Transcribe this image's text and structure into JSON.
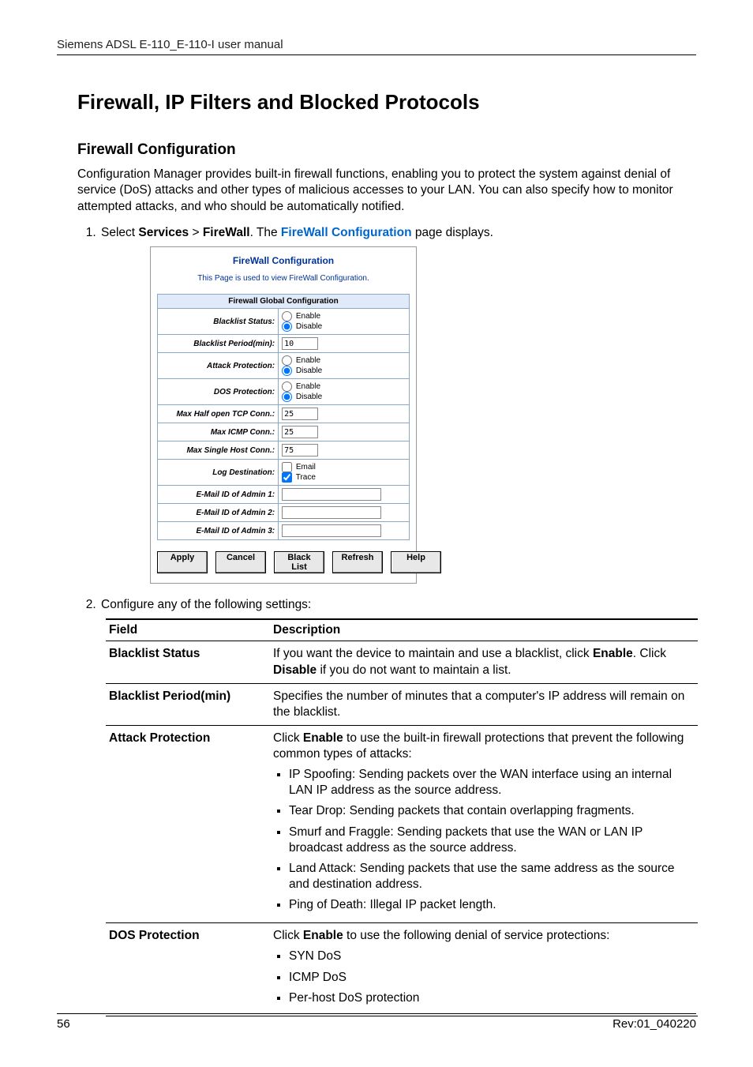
{
  "header": {
    "title": "Siemens ADSL E-110_E-110-I user manual"
  },
  "headings": {
    "h1": "Firewall, IP Filters and Blocked Protocols",
    "h2": "Firewall Configuration"
  },
  "intro": "Configuration Manager provides built-in firewall functions, enabling you to protect the system against denial of service (DoS) attacks and other types of malicious accesses to your LAN. You can also specify how to monitor attempted attacks, and who should be automatically notified.",
  "steps": {
    "one_pre": "Select ",
    "one_svc": "Services",
    "one_gt": " > ",
    "one_fw": "FireWall",
    "one_mid": ". The ",
    "one_link": "FireWall Configuration",
    "one_post": " page displays.",
    "two": "Configure any of the following settings:"
  },
  "fw_panel": {
    "title": "FireWall Configuration",
    "desc": "This Page is used to view FireWall Configuration.",
    "caption": "Firewall Global Configuration",
    "rows": {
      "blacklist_status": "Blacklist Status:",
      "blacklist_period": "Blacklist Period(min):",
      "attack_protection": "Attack Protection:",
      "dos_protection": "DOS Protection:",
      "max_half_tcp": "Max Half open TCP Conn.:",
      "max_icmp": "Max ICMP Conn.:",
      "max_single": "Max Single Host Conn.:",
      "log_dest": "Log Destination:",
      "email1": "E-Mail ID of Admin 1:",
      "email2": "E-Mail ID of Admin 2:",
      "email3": "E-Mail ID of Admin 3:"
    },
    "opts": {
      "enable": "Enable",
      "disable": "Disable",
      "email": "Email",
      "trace": "Trace"
    },
    "values": {
      "blacklist_period": "10",
      "max_half_tcp": "25",
      "max_icmp": "25",
      "max_single": "75",
      "email1": "",
      "email2": "",
      "email3": ""
    },
    "buttons": {
      "apply": "Apply",
      "cancel": "Cancel",
      "blacklist": "Black List",
      "refresh": "Refresh",
      "help": "Help"
    }
  },
  "desc_table": {
    "head_field": "Field",
    "head_desc": "Description",
    "rows": {
      "blacklist_status": {
        "field": "Blacklist Status",
        "pre": "If you want the device to maintain and use a blacklist, click ",
        "bold1": "Enable",
        "mid": ". Click ",
        "bold2": "Disable",
        "post": " if you do not want to maintain a list."
      },
      "blacklist_period": {
        "field": "Blacklist Period(min)",
        "text": "Specifies the number of minutes that a computer's IP address will remain on the blacklist."
      },
      "attack": {
        "field": "Attack Protection",
        "pre": "Click ",
        "bold": "Enable",
        "post": " to use the built-in firewall protections that prevent the following common types of attacks:",
        "items": [
          "IP Spoofing: Sending packets over the WAN interface using an internal LAN IP address as the source address.",
          "Tear Drop: Sending packets that contain overlapping fragments.",
          "Smurf and Fraggle: Sending packets that use the WAN or LAN IP broadcast address as the source address.",
          "Land Attack: Sending packets that use the same address as   the source and destination address.",
          "Ping of Death: Illegal IP packet length."
        ]
      },
      "dos": {
        "field": "DOS Protection",
        "pre": "Click ",
        "bold": "Enable",
        "post": " to use the following denial of service protections:",
        "items": [
          "SYN DoS",
          "ICMP DoS",
          "Per-host DoS protection"
        ]
      }
    }
  },
  "footer": {
    "page": "56",
    "rev": "Rev:01_040220"
  }
}
